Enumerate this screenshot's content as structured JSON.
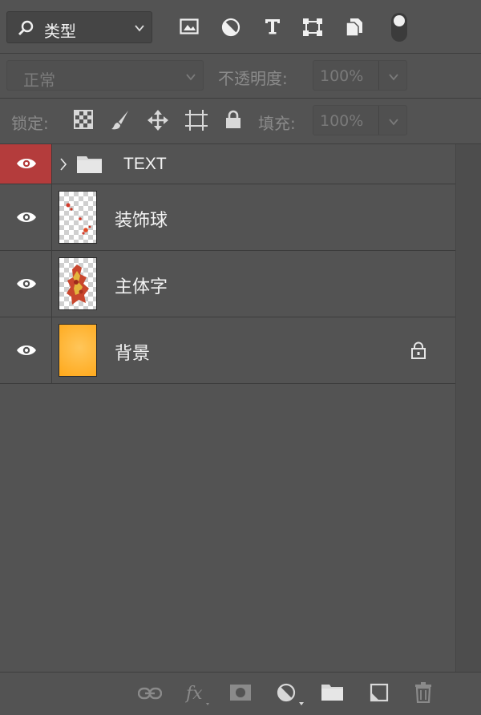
{
  "filter": {
    "kind_label": "类型",
    "icons": [
      "search-icon",
      "image-filter-icon",
      "adjustment-filter-icon",
      "type-filter-icon",
      "shape-filter-icon",
      "smart-object-filter-icon"
    ]
  },
  "blend": {
    "mode": "正常",
    "opacity_label": "不透明度:",
    "opacity_value": "100%"
  },
  "lock": {
    "label": "锁定:",
    "fill_label": "填充:",
    "fill_value": "100%"
  },
  "layers": [
    {
      "name": "TEXT",
      "type": "group",
      "visible": true,
      "selected": false
    },
    {
      "name": "装饰球",
      "type": "pixel",
      "visible": true
    },
    {
      "name": "主体字",
      "type": "pixel",
      "visible": true
    },
    {
      "name": "背景",
      "type": "background",
      "visible": true,
      "locked": true
    }
  ],
  "colors": {
    "panel_bg": "#535353",
    "highlight_red": "#b43c3c",
    "background_fill": "#ffae1f"
  }
}
